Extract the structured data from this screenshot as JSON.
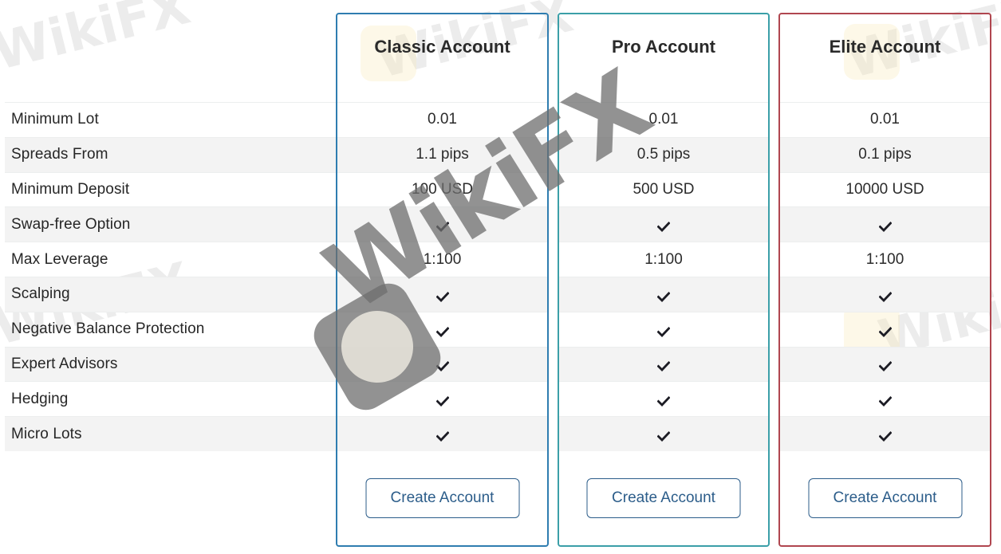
{
  "features": [
    "Minimum Lot",
    "Spreads From",
    "Minimum Deposit",
    "Swap-free Option",
    "Max Leverage",
    "Scalping",
    "Negative Balance Protection",
    "Expert Advisors",
    "Hedging",
    "Micro Lots"
  ],
  "accounts": [
    {
      "name": "Classic Account",
      "accent": "#2f7db0",
      "values": [
        "0.01",
        "1.1 pips",
        "100 USD",
        "check",
        "1:100",
        "check",
        "check",
        "check",
        "check",
        "check"
      ],
      "cta": "Create Account"
    },
    {
      "name": "Pro Account",
      "accent": "#3b9fa8",
      "values": [
        "0.01",
        "0.5 pips",
        "500 USD",
        "check",
        "1:100",
        "check",
        "check",
        "check",
        "check",
        "check"
      ],
      "cta": "Create Account"
    },
    {
      "name": "Elite Account",
      "accent": "#b0464f",
      "values": [
        "0.01",
        "0.1 pips",
        "10000 USD",
        "check",
        "1:100",
        "check",
        "check",
        "check",
        "check",
        "check"
      ],
      "cta": "Create Account"
    }
  ],
  "watermark": {
    "text": "WikiFX"
  },
  "icons": {
    "check": "check-icon"
  }
}
